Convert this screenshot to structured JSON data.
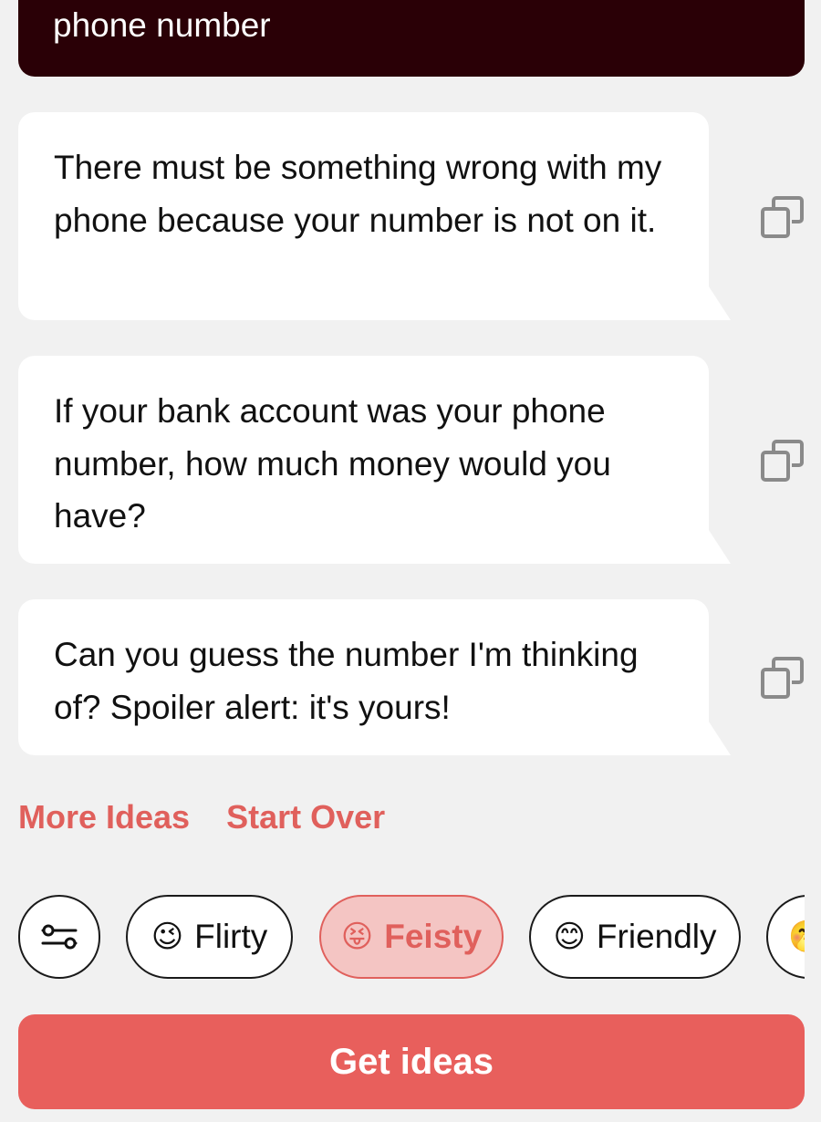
{
  "prompt": {
    "text": "phone number"
  },
  "ideas": [
    {
      "text": "There must be something wrong with my phone because your number is not on it."
    },
    {
      "text": "If your bank account was your phone number, how much money would you have?"
    },
    {
      "text": "Can you guess the number I'm thinking of? Spoiler alert: it's yours!"
    }
  ],
  "actions": {
    "more_ideas": "More Ideas",
    "start_over": "Start Over"
  },
  "tones": [
    {
      "emoji": "😉",
      "label": "Flirty",
      "selected": false
    },
    {
      "emoji": "😝",
      "label": "Feisty",
      "selected": true
    },
    {
      "emoji": "😊",
      "label": "Friendly",
      "selected": false
    },
    {
      "emoji": "🤭",
      "label": "",
      "selected": false
    }
  ],
  "get_ideas_label": "Get ideas",
  "colors": {
    "accent": "#e85f5c",
    "prompt_bg": "#2a0006",
    "page_bg": "#f1f1f1",
    "selected_chip_bg": "#f4c5c3"
  },
  "icons": {
    "copy": "copy-icon",
    "filter": "sliders-icon"
  }
}
